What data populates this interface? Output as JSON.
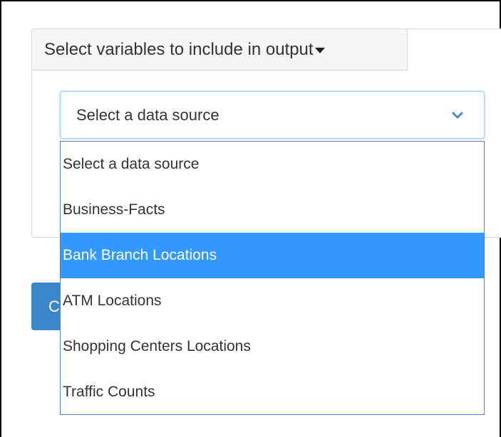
{
  "panel": {
    "header_label": "Select variables to include in output"
  },
  "select": {
    "current_value": "Select a data source",
    "options": [
      {
        "label": "Select a data source",
        "highlighted": false
      },
      {
        "label": "Business-Facts",
        "highlighted": false
      },
      {
        "label": "Bank Branch Locations",
        "highlighted": true
      },
      {
        "label": "ATM Locations",
        "highlighted": false
      },
      {
        "label": "Shopping Centers Locations",
        "highlighted": false
      },
      {
        "label": "Traffic Counts",
        "highlighted": false
      }
    ]
  },
  "button": {
    "partial_label": "C"
  },
  "colors": {
    "highlight": "#3399ff",
    "button": "#3a86c8",
    "select_border": "#9ecaed"
  }
}
